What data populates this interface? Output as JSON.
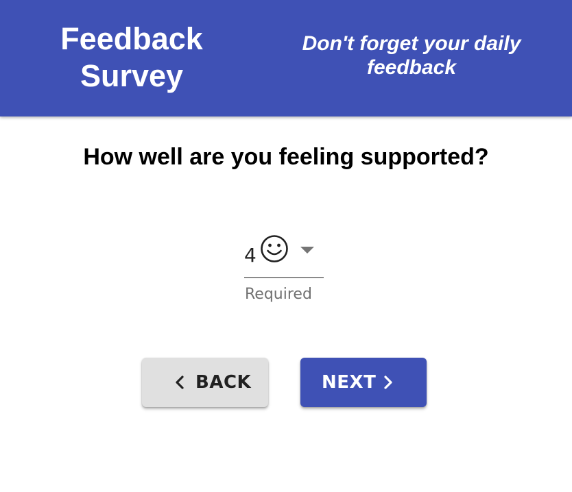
{
  "header": {
    "title_line1": "Feedback",
    "title_line2": "Survey",
    "tagline_line1": "Don't forget your daily",
    "tagline_line2": "feedback"
  },
  "question": {
    "text": "How well are you feeling supported?"
  },
  "rating_select": {
    "value": "4",
    "value_icon": "smiley-face-icon",
    "helper_text": "Required"
  },
  "navigation": {
    "back_label": "BACK",
    "next_label": "NEXT"
  },
  "colors": {
    "primary": "#3f51b5",
    "secondary_button": "#e0e0e0",
    "helper_text": "#707070"
  }
}
